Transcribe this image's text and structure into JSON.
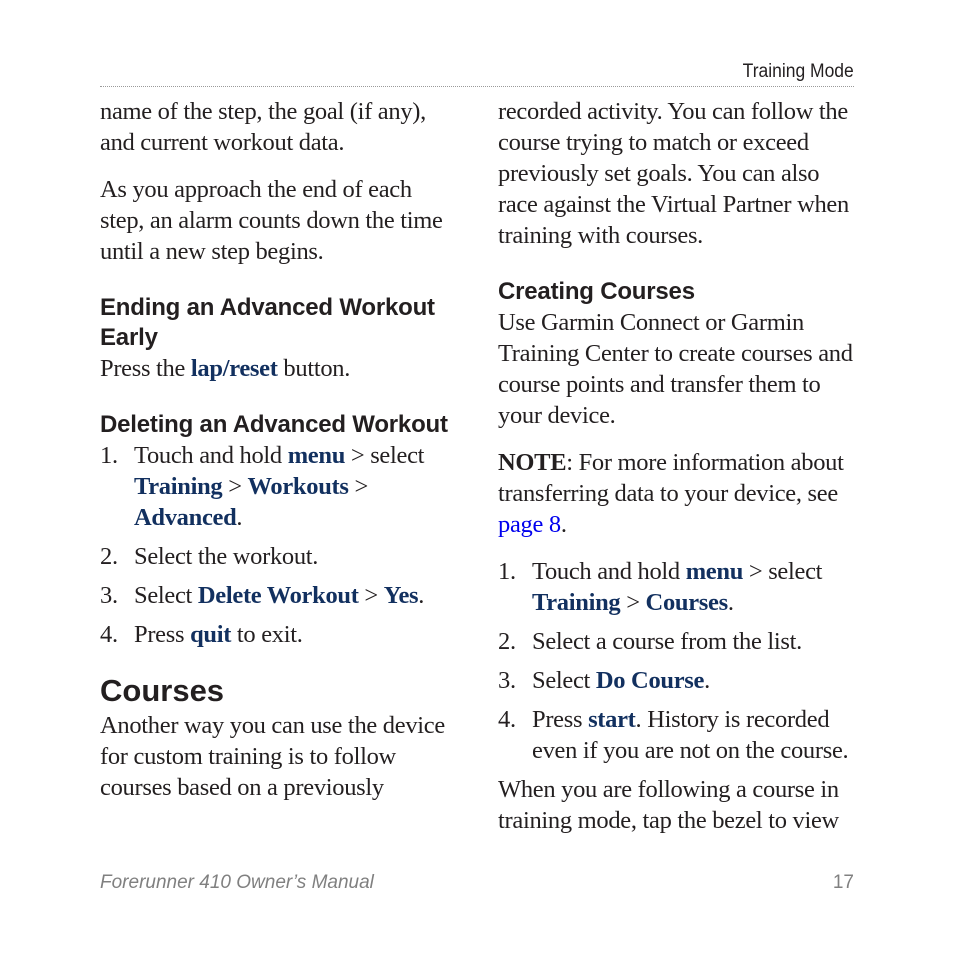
{
  "header": {
    "section_title": "Training Mode"
  },
  "left_column": {
    "intro_para1": "name of the step, the goal (if any), and current workout data.",
    "intro_para2": "As you approach the end of each step, an alarm counts down the time until a new step begins.",
    "ending_heading": "Ending an Advanced Workout Early",
    "ending_text": {
      "pre": "Press the ",
      "kw": "lap/reset",
      "post": " button."
    },
    "deleting_heading": "Deleting an Advanced Workout",
    "deleting_steps": [
      {
        "num": "1.",
        "t1": "Touch and hold ",
        "k1": "menu",
        "t2": " > select ",
        "k2": "Training",
        "t3": " > ",
        "k3": "Workouts",
        "t4": " > ",
        "k4": "Advanced",
        "t5": "."
      },
      {
        "num": "2.",
        "text": "Select the workout."
      },
      {
        "num": "3.",
        "t1": "Select ",
        "k1": "Delete Workout",
        "t2": " > ",
        "k2": "Yes",
        "t3": "."
      },
      {
        "num": "4.",
        "t1": "Press ",
        "k1": "quit",
        "t2": " to exit."
      }
    ],
    "courses_heading": "Courses",
    "courses_para": "Another way you can use the device for custom training is to follow courses based on a previously"
  },
  "right_column": {
    "cont_para": "recorded activity. You can follow the course trying to match or exceed previously set goals. You can also race against the Virtual Partner when training with courses.",
    "creating_heading": "Creating Courses",
    "creating_para": "Use Garmin Connect or Garmin Training Center to create courses and course points and transfer them to your device.",
    "note": {
      "label": "NOTE",
      "text": ": For more information about transferring data to your device, see ",
      "link": "page 8",
      "end": "."
    },
    "steps": [
      {
        "num": "1.",
        "t1": "Touch and hold ",
        "k1": "menu",
        "t2": " > select ",
        "k2": "Training",
        "t3": " > ",
        "k3": "Courses",
        "t4": "."
      },
      {
        "num": "2.",
        "text": "Select a course from the list."
      },
      {
        "num": "3.",
        "t1": "Select ",
        "k1": "Do Course",
        "t2": "."
      },
      {
        "num": "4.",
        "t1": "Press ",
        "k1": "start",
        "t2": ". History is recorded even if you are not on the course."
      }
    ],
    "closing_para": "When you are following a course in training mode, tap the bezel to view"
  },
  "footer": {
    "manual_title": "Forerunner 410 Owner’s Manual",
    "page_number": "17"
  },
  "colors": {
    "keyword": "#12305f",
    "link": "#0000ee",
    "footer": "#808080"
  }
}
